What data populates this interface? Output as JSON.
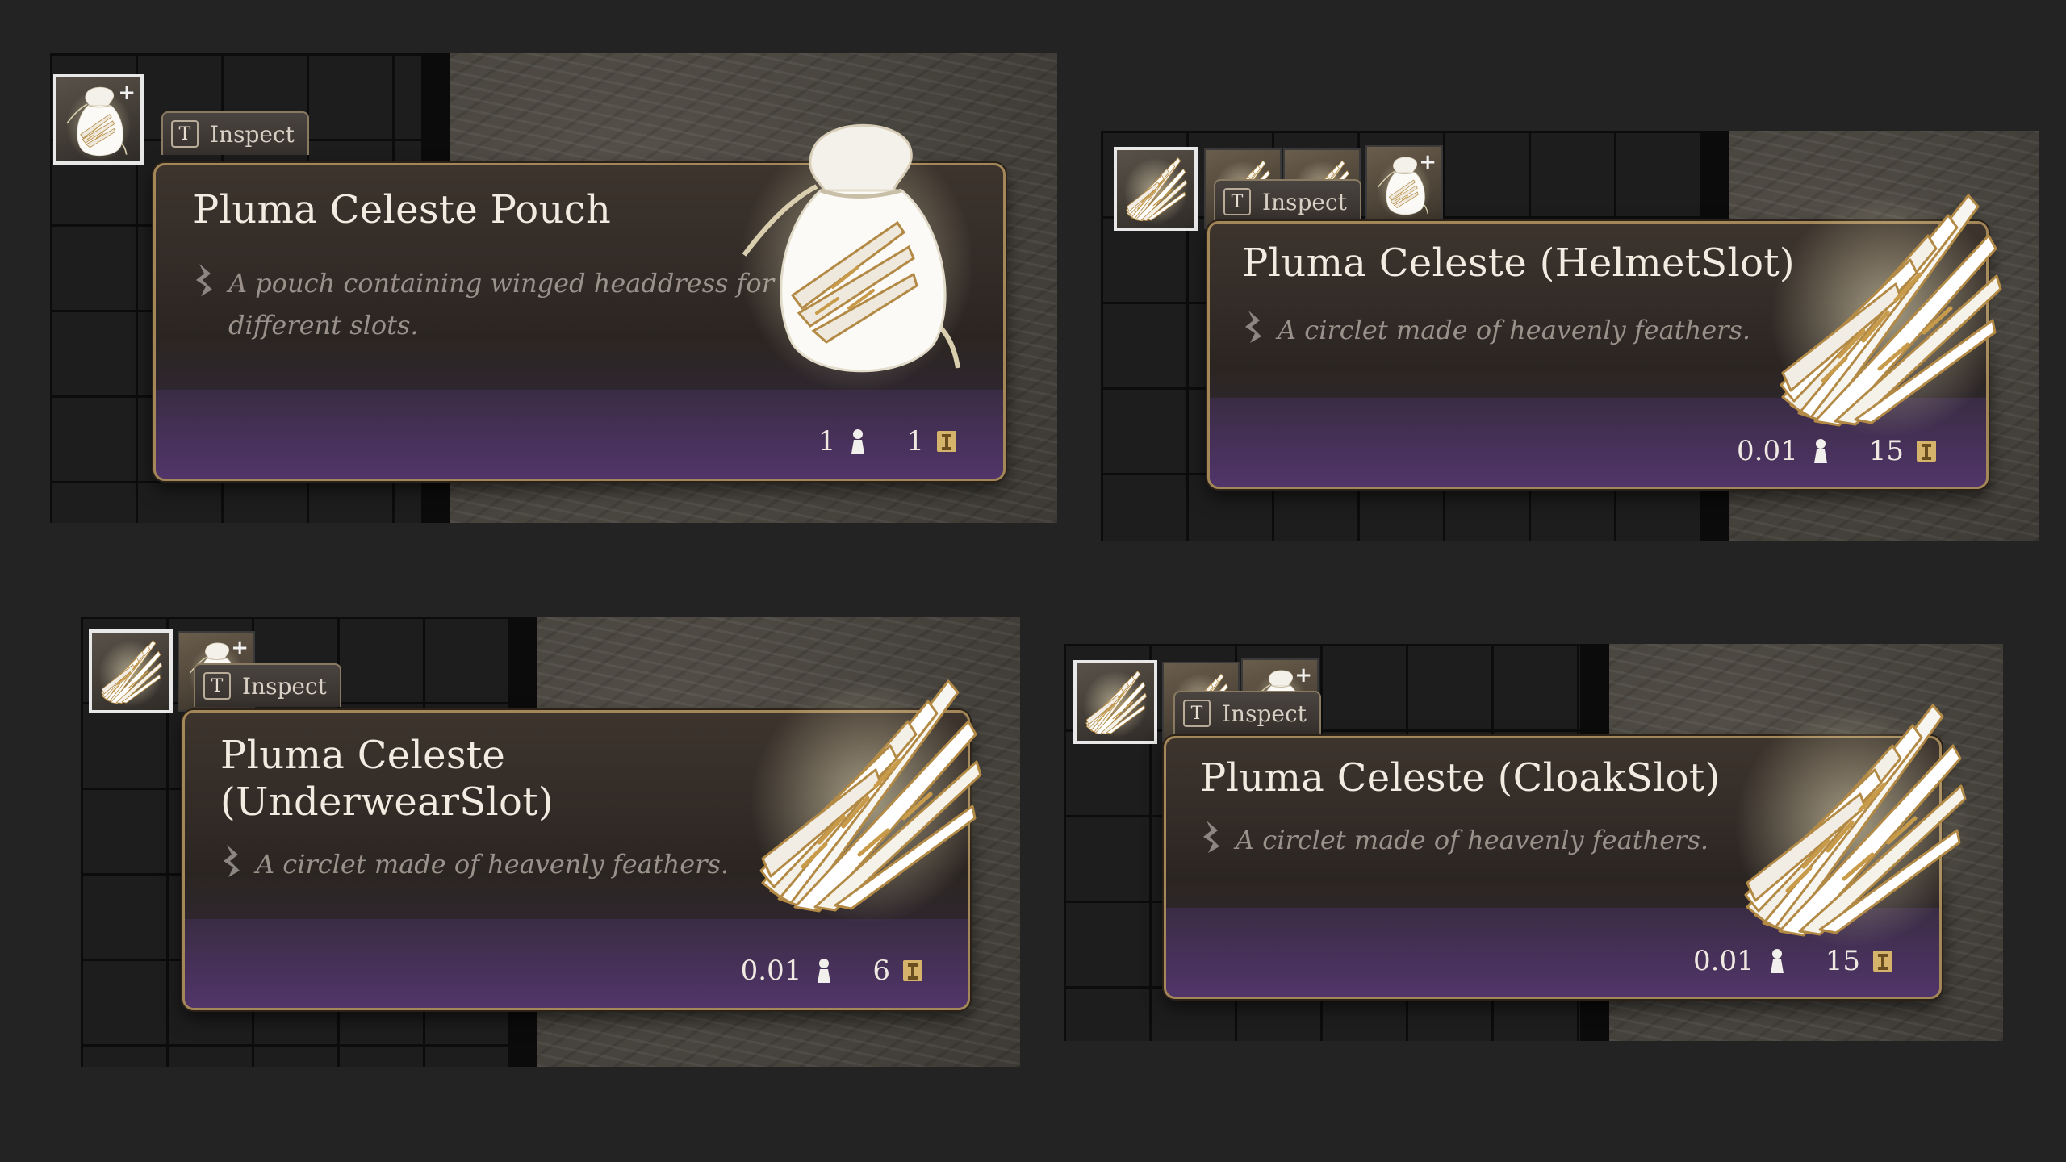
{
  "inspect": {
    "key": "T",
    "label": "Inspect"
  },
  "tooltips": [
    {
      "title_lines": [
        "Pluma Celeste Pouch"
      ],
      "description_lines": [
        "A pouch containing winged headdress for",
        "different slots."
      ],
      "weight": "1",
      "value": "1",
      "art": "pouch-icon"
    },
    {
      "title_lines": [
        "Pluma Celeste (HelmetSlot)"
      ],
      "description_lines": [
        "A circlet made of heavenly feathers."
      ],
      "weight": "0.01",
      "value": "15",
      "art": "wing-icon"
    },
    {
      "title_lines": [
        "Pluma Celeste",
        "(UnderwearSlot)"
      ],
      "description_lines": [
        "A circlet made of heavenly feathers."
      ],
      "weight": "0.01",
      "value": "6",
      "art": "wing-icon"
    },
    {
      "title_lines": [
        "Pluma Celeste (CloakSlot)"
      ],
      "description_lines": [
        "A circlet made of heavenly feathers."
      ],
      "weight": "0.01",
      "value": "15",
      "art": "wing-icon"
    }
  ],
  "colors": {
    "background": "#232323",
    "tooltip_border": "#a38759",
    "footer_purple": "#51356a",
    "title_text": "#f1ebe1",
    "description_text": "#9a928a"
  }
}
